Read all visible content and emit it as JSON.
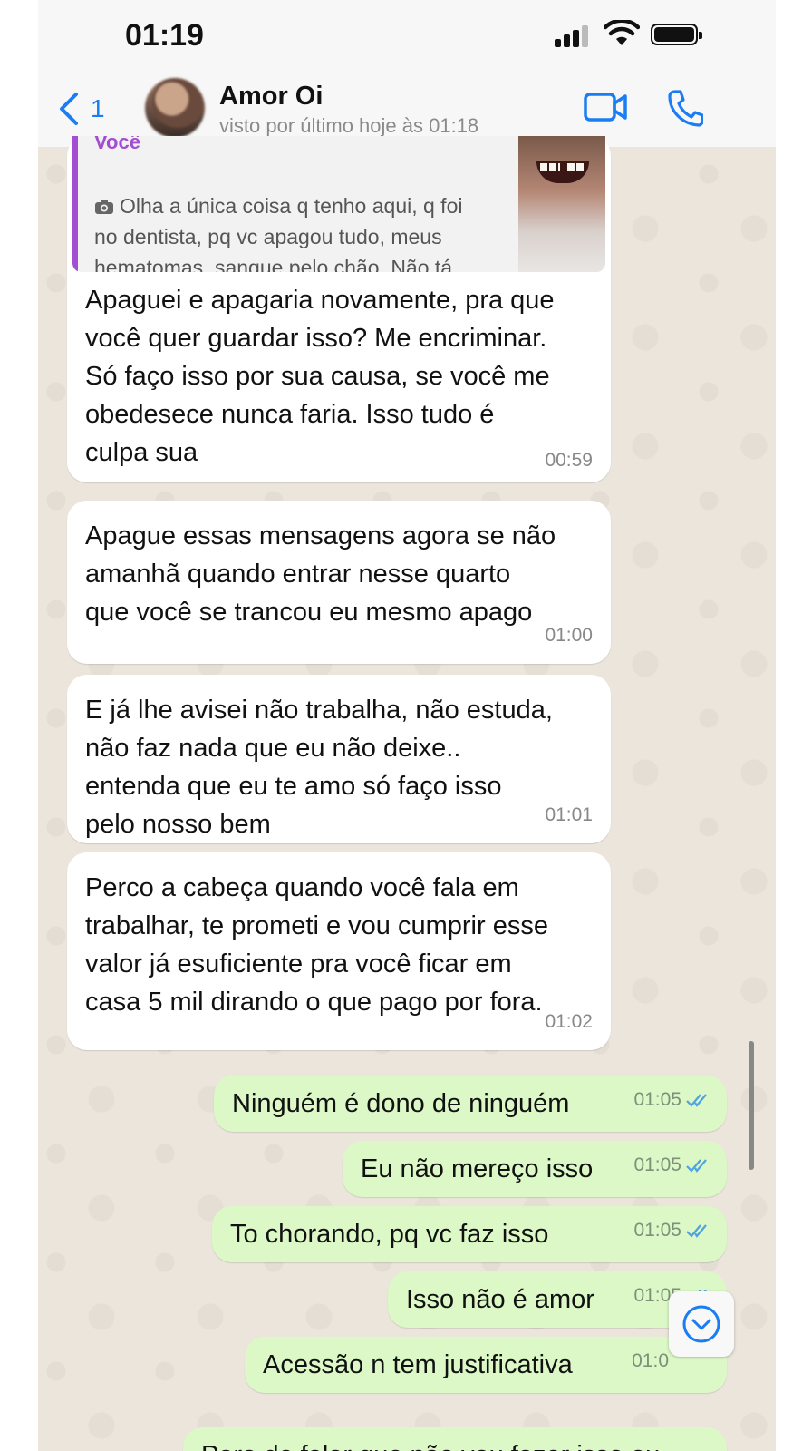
{
  "status_bar": {
    "time": "01:19"
  },
  "header": {
    "back_count": "1",
    "contact_name": "Amor Oi",
    "last_seen": "visto por último hoje às 01:18"
  },
  "quoted": {
    "author": "Você",
    "text": "Olha a única coisa q tenho aqui, q foi\nno dentista, pq vc apagou tudo, meus\nhematomas, sangue pelo chão. Não tá…"
  },
  "messages": [
    {
      "text": "Apaguei e apagaria novamente, pra que\nvocê quer guardar isso? Me encriminar.\nSó faço isso por sua causa, se você me\nobedesece nunca faria. Isso tudo é\nculpa sua",
      "time": "00:59"
    },
    {
      "text": "Apague essas mensagens agora se não\namanhã quando entrar nesse quarto\nque você se trancou eu mesmo apago",
      "time": "01:00"
    },
    {
      "text": "E já lhe avisei não trabalha, não estuda,\nnão faz nada que eu não deixe..\nentenda que eu te amo só faço isso\npelo nosso bem",
      "time": "01:01"
    },
    {
      "text": "Perco a cabeça quando você fala em\ntrabalhar, te prometi e vou cumprir esse\nvalor já esuficiente pra você ficar em\ncasa 5 mil dirando o que pago por fora.",
      "time": "01:02"
    }
  ],
  "outgoing": [
    {
      "text": "Ninguém é dono de ninguém",
      "time": "01:05"
    },
    {
      "text": "Eu não mereço isso",
      "time": "01:05"
    },
    {
      "text": "To chorando, pq vc faz isso",
      "time": "01:05"
    },
    {
      "text": "Isso não é amor",
      "time": "01:05"
    },
    {
      "text": "Acessão n tem justificativa",
      "time": "01:0"
    },
    {
      "text": "Para de falar que não vou fazer isso ou",
      "time": ""
    }
  ],
  "colors": {
    "accent_blue": "#1a7ef2",
    "incoming_bubble": "#ffffff",
    "outgoing_bubble": "#dcf8c6",
    "quote_author": "#a34ed0",
    "read_ticks": "#4fa3e0"
  },
  "icons": {
    "back": "chevron-left-icon",
    "video": "video-camera-icon",
    "call": "phone-icon",
    "quote_media": "camera-icon",
    "scroll": "chevron-down-circle-icon"
  }
}
